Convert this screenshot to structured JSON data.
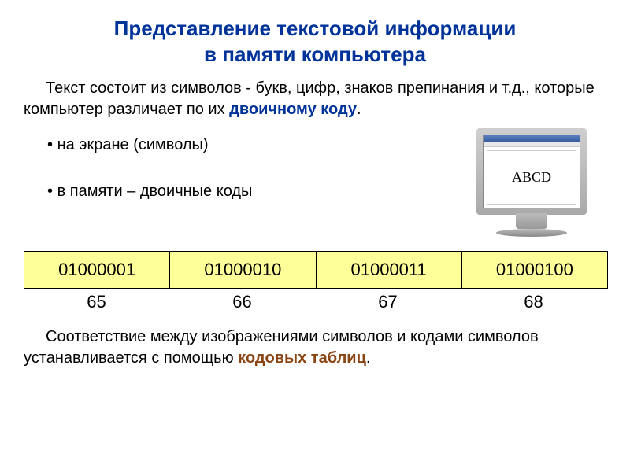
{
  "title_line1": "Представление текстовой информации",
  "title_line2": "в памяти компьютера",
  "para1_a": "Текст состоит из символов - букв, цифр, знаков препинания и  т.д.,  которые компьютер различает по их ",
  "para1_emph": "двоичному коду",
  "para1_b": ".",
  "bullet1": "на экране (символы)",
  "bullet2": "в памяти – двоичные коды",
  "screen_text": "ABCD",
  "codes": {
    "bin": [
      "01000001",
      "01000010",
      "01000011",
      "01000100"
    ],
    "dec": [
      "65",
      "66",
      "67",
      "68"
    ]
  },
  "para2_a": "Соответствие между изображениями символов и кодами символов устанавливается с помощью ",
  "para2_emph": "кодовых таблиц",
  "para2_b": "."
}
